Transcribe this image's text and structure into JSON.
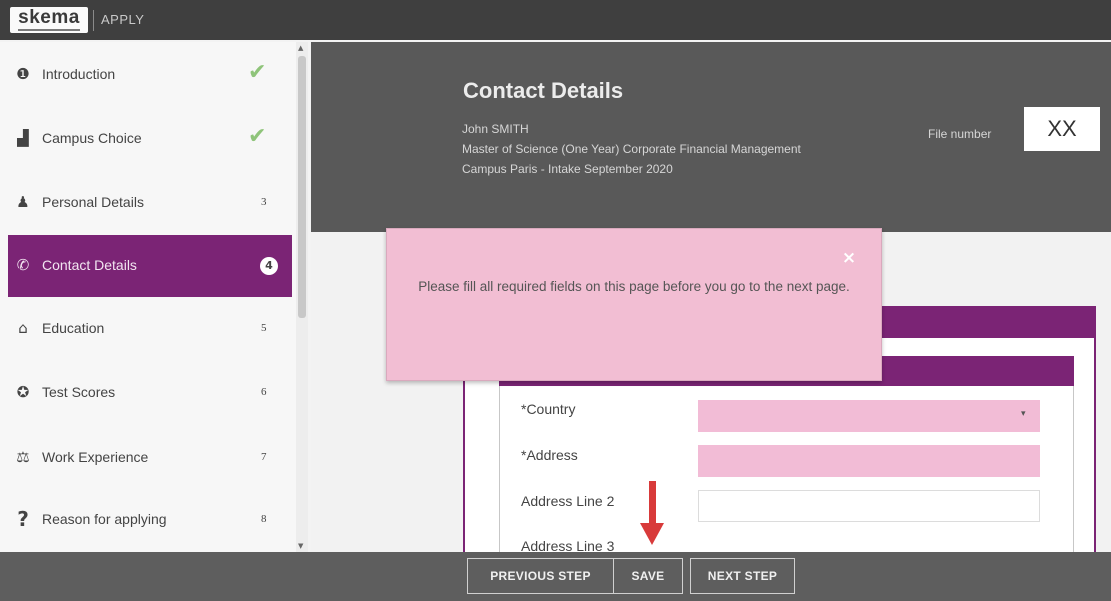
{
  "topbar": {
    "logo": "skema",
    "app": "APPLY"
  },
  "sidebar": {
    "items": [
      {
        "label": "Introduction",
        "icon": "info-icon",
        "glyph": "❶",
        "status": "done"
      },
      {
        "label": "Campus Choice",
        "icon": "buildings-icon",
        "glyph": "▟",
        "status": "done"
      },
      {
        "label": "Personal Details",
        "icon": "user-icon",
        "glyph": "♟",
        "step": "3"
      },
      {
        "label": "Contact Details",
        "icon": "phone-icon",
        "glyph": "✆",
        "step": "4",
        "active": true
      },
      {
        "label": "Education",
        "icon": "university-icon",
        "glyph": "⌂",
        "step": "5"
      },
      {
        "label": "Test Scores",
        "icon": "medal-icon",
        "glyph": "✪",
        "step": "6"
      },
      {
        "label": "Work Experience",
        "icon": "briefcase-icon",
        "glyph": "⚖",
        "step": "7"
      },
      {
        "label": "Reason for applying",
        "icon": "question-icon",
        "glyph": "?",
        "step": "8"
      }
    ],
    "check_glyph": "✔"
  },
  "header": {
    "title": "Contact Details",
    "applicant_name": "John SMITH",
    "program": "Master of Science (One Year) Corporate Financial Management",
    "campus_intake": "Campus Paris - Intake September 2020",
    "file_number_label": "File number",
    "file_number_value": "XX"
  },
  "alert": {
    "message": "Please fill all required fields on this page before you go to the next page.",
    "close_glyph": "×"
  },
  "form": {
    "fields": [
      {
        "label": "*Country",
        "value": "",
        "required": true,
        "type": "select"
      },
      {
        "label": "*Address",
        "value": "",
        "required": true,
        "type": "text"
      },
      {
        "label": "Address Line 2",
        "value": "",
        "required": false,
        "type": "text"
      },
      {
        "label": "Address Line 3",
        "value": "",
        "required": false,
        "type": "text"
      }
    ]
  },
  "footer": {
    "previous": "PREVIOUS STEP",
    "save": "SAVE",
    "next": "NEXT STEP"
  },
  "colors": {
    "brand": "#7b2475",
    "header_bg": "#595959",
    "alert_bg": "#f2bed3",
    "required_field": "#f2bcd6",
    "annotation_arrow": "#d83a3a"
  }
}
